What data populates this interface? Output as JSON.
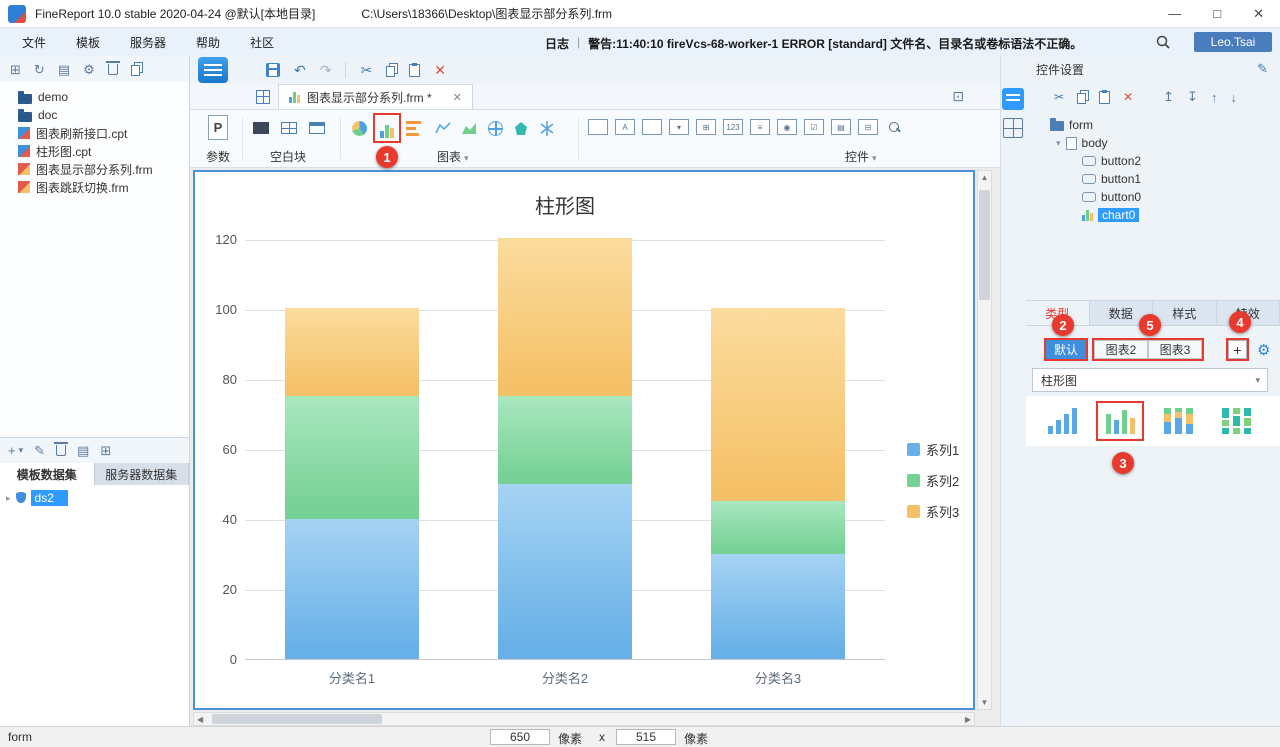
{
  "title_bar": {
    "app_name": "FineReport 10.0 stable 2020-04-24 @默认[本地目录]",
    "file_path": "C:\\Users\\18366\\Desktop\\图表显示部分系列.frm",
    "window_controls": {
      "minimize": "—",
      "maximize": "□",
      "close": "✕"
    }
  },
  "menu_bar": {
    "items": [
      {
        "label": "文件"
      },
      {
        "label": "模板"
      },
      {
        "label": "服务器"
      },
      {
        "label": "帮助"
      },
      {
        "label": "社区"
      }
    ],
    "log_label": "日志",
    "separator": "|",
    "warning_text": "警告:11:40:10 fireVcs-68-worker-1 ERROR [standard] 文件名、目录名或卷标语法不正确。",
    "user_name": "Leo.Tsai"
  },
  "left_panel": {
    "tree_items": [
      {
        "label": "demo",
        "kind": "folder"
      },
      {
        "label": "doc",
        "kind": "folder"
      },
      {
        "label": "图表刷新接口.cpt",
        "kind": "cpt"
      },
      {
        "label": "柱形图.cpt",
        "kind": "cpt"
      },
      {
        "label": "图表显示部分系列.frm",
        "kind": "frm"
      },
      {
        "label": "图表跳跃切换.frm",
        "kind": "frm"
      }
    ],
    "dataset_tabs": [
      {
        "label": "模板数据集",
        "active": true
      },
      {
        "label": "服务器数据集",
        "active": false
      }
    ],
    "datasets": [
      {
        "label": "ds2"
      }
    ]
  },
  "document_tab": {
    "title": "图表显示部分系列.frm *"
  },
  "palette": {
    "param_button": "P",
    "param_label": "参数",
    "blank_label": "空白块",
    "chart_label": "图表",
    "widget_label": "控件",
    "widget_icons": [
      {
        "name": "textfield-icon",
        "glyph": ""
      },
      {
        "name": "label-icon",
        "glyph": "A"
      },
      {
        "name": "button-icon",
        "glyph": ""
      },
      {
        "name": "combobox-icon",
        "glyph": "▾"
      },
      {
        "name": "combo-grid-icon",
        "glyph": "⊞"
      },
      {
        "name": "number-field-icon",
        "glyph": "123"
      },
      {
        "name": "textarea-icon",
        "glyph": "≡"
      },
      {
        "name": "radio-group-icon",
        "glyph": "◉"
      },
      {
        "name": "checkbox-group-icon",
        "glyph": "☑"
      },
      {
        "name": "list-view-icon",
        "glyph": "▤"
      },
      {
        "name": "tree-widget-icon",
        "glyph": "⊟"
      },
      {
        "name": "query-button-icon",
        "glyph": ""
      }
    ]
  },
  "status_bar": {
    "form_label": "form",
    "width_value": "650",
    "unit1": "像素",
    "times": "x",
    "height_value": "515",
    "unit2": "像素"
  },
  "right_panel": {
    "header_title": "控件设置",
    "tree": [
      {
        "label": "form",
        "kind": "form",
        "indent": 0
      },
      {
        "label": "body",
        "kind": "body",
        "indent": 1
      },
      {
        "label": "button2",
        "kind": "button",
        "indent": 2
      },
      {
        "label": "button1",
        "kind": "button",
        "indent": 2
      },
      {
        "label": "button0",
        "kind": "button",
        "indent": 2
      },
      {
        "label": "chart0",
        "kind": "chart",
        "indent": 2,
        "selected": true
      }
    ],
    "tabs": [
      {
        "label": "类型",
        "active": true,
        "highlight": true
      },
      {
        "label": "数据"
      },
      {
        "label": "样式"
      },
      {
        "label": "特效"
      }
    ],
    "chart_tabs": [
      {
        "label": "默认",
        "active": true
      },
      {
        "label": "图表2"
      },
      {
        "label": "图表3"
      }
    ],
    "add_chart_button": "+",
    "chart_type_select": "柱形图"
  },
  "annotations": [
    {
      "number": "1"
    },
    {
      "number": "2"
    },
    {
      "number": "3"
    },
    {
      "number": "4"
    },
    {
      "number": "5"
    }
  ],
  "glyphs": {
    "new_template": "⊞",
    "refresh": "↻",
    "view": "▤",
    "settings": "⚙",
    "undo": "↶",
    "redo": "↷",
    "cut": "✂",
    "delete": "✕",
    "plus": "+",
    "caret_down": "▾",
    "caret_right": "▸",
    "pencil": "✎",
    "gear": "⚙",
    "fit": "⊡",
    "chevron_down": "▾",
    "up": "▲",
    "down": "▼",
    "left": "◀",
    "right": "▶",
    "move_top": "↥",
    "move_bottom": "↧",
    "move_up": "↑",
    "move_down": "↓",
    "close": "✕"
  },
  "chart_data": {
    "type": "bar",
    "stacked": true,
    "title": "柱形图",
    "categories": [
      "分类名1",
      "分类名2",
      "分类名3"
    ],
    "series": [
      {
        "name": "系列1",
        "color": "#68b1e8",
        "color_light": "#a6d3f3",
        "values": [
          40,
          50,
          30
        ]
      },
      {
        "name": "系列2",
        "color": "#76d195",
        "color_light": "#aae7c0",
        "values": [
          35,
          25,
          15
        ]
      },
      {
        "name": "系列3",
        "color": "#f5c168",
        "color_light": "#fbdc9e",
        "values": [
          25,
          45,
          55
        ]
      }
    ],
    "ylim": [
      0,
      120
    ],
    "yticks": [
      0,
      20,
      40,
      60,
      80,
      100,
      120
    ],
    "legend_position": "right",
    "grid": true
  }
}
